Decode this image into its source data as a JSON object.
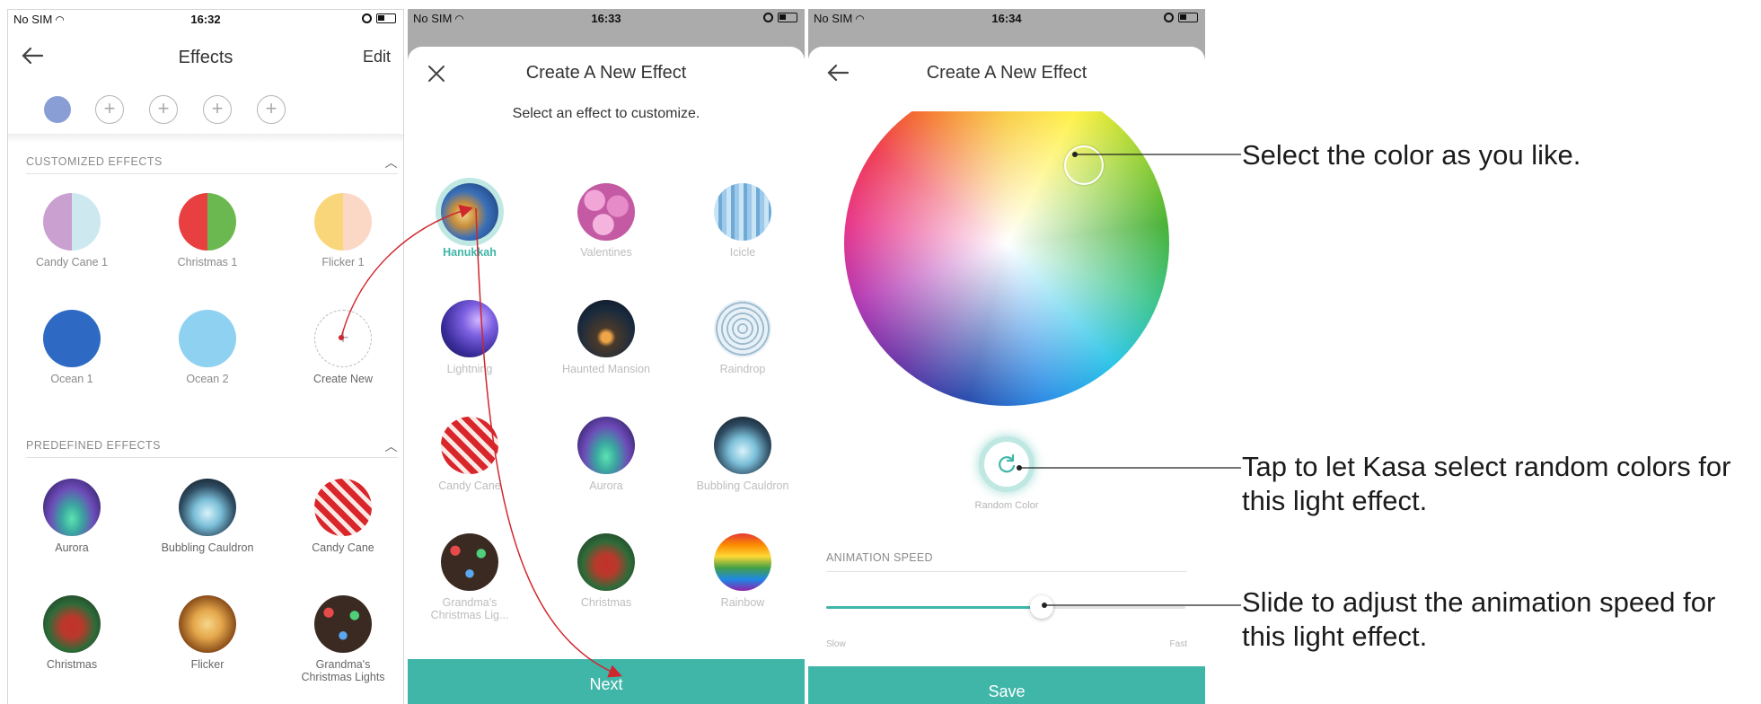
{
  "screen1": {
    "status": {
      "carrier": "No SIM",
      "time": "16:32"
    },
    "title": "Effects",
    "edit_label": "Edit",
    "slot_colors": [
      "#8a9ed6"
    ],
    "customized_header": "CUSTOMIZED EFFECTS",
    "customized": [
      {
        "label": "Candy Cane 1",
        "colors": [
          "#c9a0d0",
          "#cde8ef"
        ]
      },
      {
        "label": "Christmas 1",
        "colors": [
          "#e84040",
          "#6ab84f"
        ]
      },
      {
        "label": "Flicker 1",
        "colors": [
          "#fad67a",
          "#fbd7c5"
        ]
      },
      {
        "label": "Ocean 1",
        "colors": [
          "#2e6ac4"
        ]
      },
      {
        "label": "Ocean 2",
        "colors": [
          "#8fd1f0"
        ]
      },
      {
        "label": "Create New",
        "icon": "plus-icon"
      }
    ],
    "predefined_header": "PREDEFINED EFFECTS",
    "predefined": [
      {
        "label": "Aurora"
      },
      {
        "label": "Bubbling Cauldron"
      },
      {
        "label": "Candy Cane"
      },
      {
        "label": "Christmas"
      },
      {
        "label": "Flicker"
      },
      {
        "label": "Grandma's Christmas Lights"
      }
    ]
  },
  "screen2": {
    "status": {
      "carrier": "No SIM",
      "time": "16:33"
    },
    "title": "Create A New Effect",
    "subtitle": "Select an effect to customize.",
    "effects": [
      {
        "label": "Hanukkah",
        "selected": true
      },
      {
        "label": "Valentines"
      },
      {
        "label": "Icicle"
      },
      {
        "label": "Lightning"
      },
      {
        "label": "Haunted Mansion"
      },
      {
        "label": "Raindrop"
      },
      {
        "label": "Candy Cane"
      },
      {
        "label": "Aurora"
      },
      {
        "label": "Bubbling Cauldron"
      },
      {
        "label": "Grandma's Christmas Lig..."
      },
      {
        "label": "Christmas"
      },
      {
        "label": "Rainbow"
      }
    ],
    "next_label": "Next"
  },
  "screen3": {
    "status": {
      "carrier": "No SIM",
      "time": "16:34"
    },
    "title": "Create A New Effect",
    "random_label": "Random Color",
    "speed_header": "ANIMATION SPEED",
    "speed_value": 0.6,
    "slow_label": "Slow",
    "fast_label": "Fast",
    "save_label": "Save"
  },
  "annotations": {
    "color": "Select the color as you like.",
    "random_line1": "Tap to let Kasa select random colors for",
    "random_line2": "this light effect.",
    "speed_line1": "Slide to adjust the animation speed for",
    "speed_line2": "this light effect."
  },
  "colors": {
    "accent": "#40b6a9",
    "arrow": "#d0262e"
  }
}
